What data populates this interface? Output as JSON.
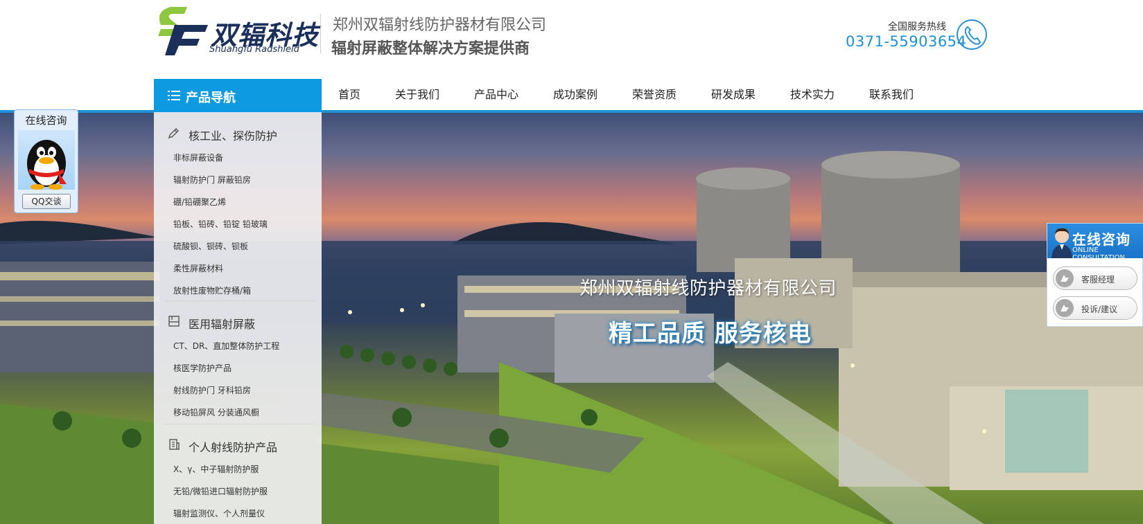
{
  "header": {
    "logo_cn": "双辐科技",
    "logo_en": "Shuangfu Radshield",
    "company_name": "郑州双辐射线防护器材有限公司",
    "slogan": "辐射屏蔽整体解决方案提供商",
    "hotline_label": "全国服务热线",
    "hotline_number": "0371-55903654"
  },
  "nav": {
    "product_nav_title": "产品导航",
    "items": [
      "首页",
      "关于我们",
      "产品中心",
      "成功案例",
      "荣誉资质",
      "研发成果",
      "技术实力",
      "联系我们"
    ]
  },
  "sidebar": {
    "categories": [
      {
        "title": "核工业、探伤防护",
        "icon": "pencil-icon",
        "items": [
          "非标屏蔽设备",
          "辐射防护门 屏蔽铅房",
          "硼/铅硼聚乙烯",
          "铅板、铅砖、铅锭 铅玻璃",
          "硫酸钡、钡砖、钡板",
          "柔性屏蔽材料",
          "放射性废物贮存桶/箱"
        ]
      },
      {
        "title": "医用辐射屏蔽",
        "icon": "book-icon",
        "items": [
          "CT、DR、直加整体防护工程",
          "核医学防护产品",
          "射线防护门 牙科铅房",
          "移动铅屏风 分装通风橱"
        ]
      },
      {
        "title": "个人射线防护产品",
        "icon": "building-icon",
        "items": [
          "X、γ、中子辐射防护服",
          "无铅/微铅进口辐射防护服",
          "辐射监测仪、个人剂量仪"
        ]
      }
    ]
  },
  "banner": {
    "title": "郑州双辐射线防护器材有限公司",
    "slogan": "精工品质 服务核电"
  },
  "qq_widget": {
    "title": "在线咨询",
    "button": "QQ交谈"
  },
  "consult_widget": {
    "title_cn": "在线咨询",
    "title_en": "ONLINE CONSULTATION",
    "buttons": [
      "客服经理",
      "投诉/建议"
    ]
  },
  "colors": {
    "accent_blue": "#0d9ae0",
    "logo_green": "#8dc63f",
    "logo_navy": "#1a2f5a",
    "hotline_blue": "#1e90d6"
  }
}
